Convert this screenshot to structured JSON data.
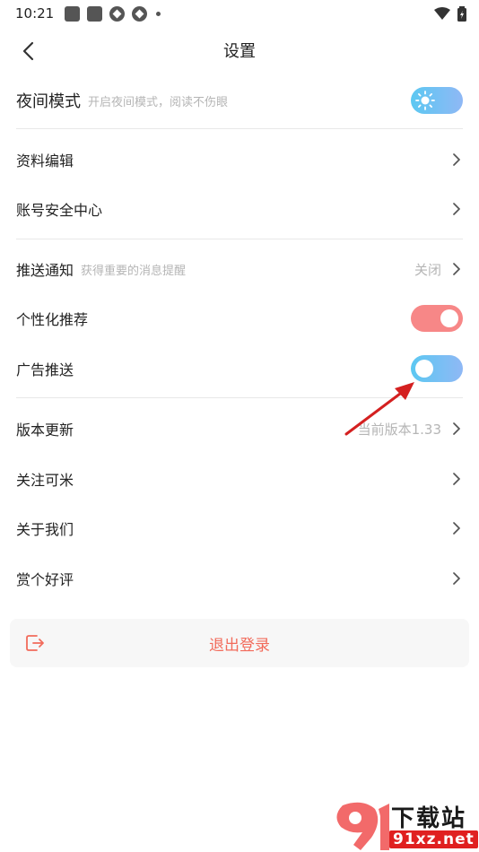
{
  "status_bar": {
    "time": "10:21"
  },
  "header": {
    "title": "设置"
  },
  "night_mode": {
    "label": "夜间模式",
    "sub": "开启夜间模式，阅读不伤眼",
    "enabled": false
  },
  "profile": {
    "edit_label": "资料编辑",
    "security_label": "账号安全中心"
  },
  "notifications": {
    "push_label": "推送通知",
    "push_sub": "获得重要的消息提醒",
    "push_value": "关闭",
    "personalized_label": "个性化推荐",
    "personalized_enabled": true,
    "ad_label": "广告推送",
    "ad_enabled": false
  },
  "about": {
    "update_label": "版本更新",
    "update_value": "当前版本1.33",
    "follow_label": "关注可米",
    "about_label": "关于我们",
    "rate_label": "赏个好评"
  },
  "logout": {
    "label": "退出登录"
  },
  "watermark": {
    "top": "下载站",
    "bottom": "91xz.net"
  },
  "colors": {
    "accent_red": "#f26b5b",
    "toggle_on_red": "#f78787",
    "toggle_blue": "#5cc8f2"
  }
}
